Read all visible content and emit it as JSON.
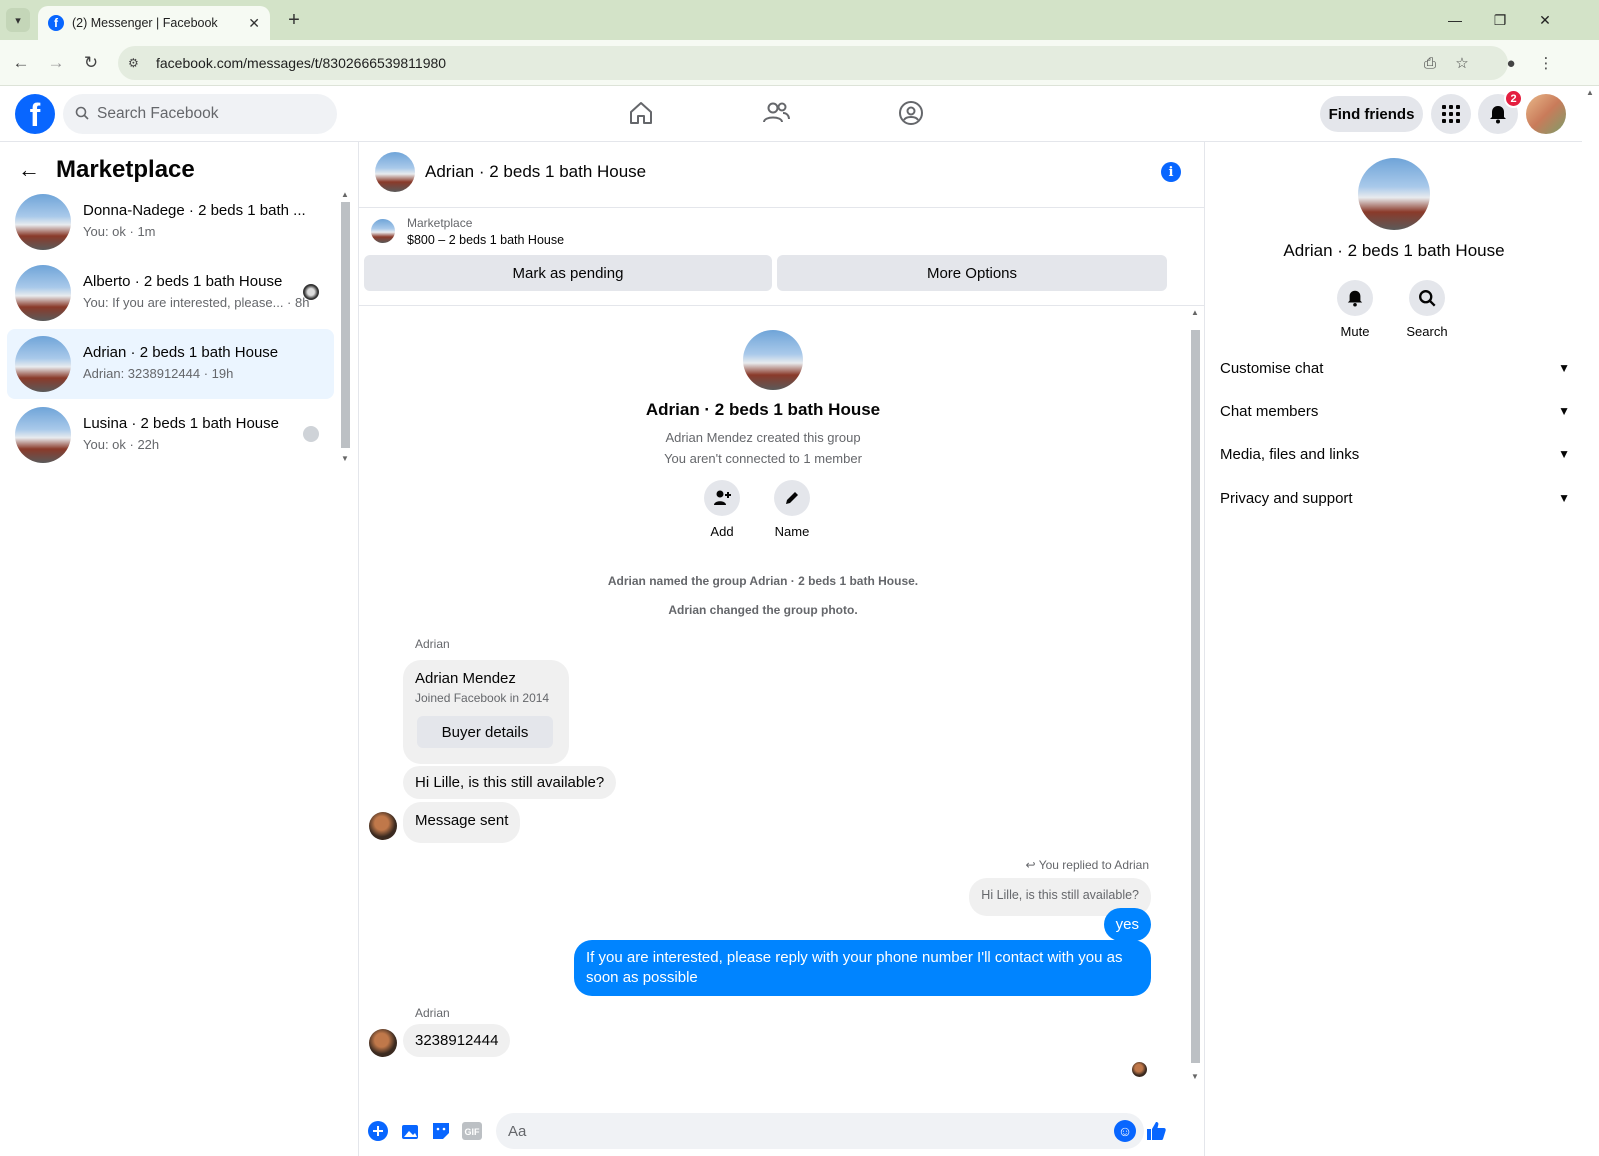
{
  "browser": {
    "tab_title": "(2) Messenger | Facebook",
    "url": "facebook.com/messages/t/8302666539811980"
  },
  "header": {
    "search_placeholder": "Search Facebook",
    "find_friends": "Find friends",
    "notification_count": "2"
  },
  "sidebar": {
    "title": "Marketplace",
    "conversations": [
      {
        "name": "Donna-Nadege · 2 beds 1 bath ...",
        "preview": "You: ok · 1m",
        "active": false
      },
      {
        "name": "Alberto · 2 beds 1 bath House",
        "preview": "You: If you are interested, please... · 8h",
        "active": false
      },
      {
        "name": "Adrian · 2 beds 1 bath House",
        "preview": "Adrian: 3238912444 · 19h",
        "active": true
      },
      {
        "name": "Lusina · 2 beds 1 bath House",
        "preview": "You: ok · 22h",
        "active": false
      }
    ]
  },
  "chat": {
    "title": "Adrian · 2 beds 1 bath House",
    "marketplace_label": "Marketplace",
    "listing": "$800 – 2 beds 1 bath House",
    "mark_pending": "Mark as pending",
    "more_options": "More Options",
    "group_name": "Adrian · 2 beds 1 bath House",
    "created_by": "Adrian Mendez created this group",
    "connection": "You aren't connected to 1 member",
    "add_label": "Add",
    "name_label": "Name",
    "sys_named": "Adrian named the group Adrian · 2 beds 1 bath House.",
    "sys_photo": "Adrian changed the group photo.",
    "sender_1": "Adrian",
    "card_name": "Adrian Mendez",
    "card_joined": "Joined Facebook in 2014",
    "buyer_details": "Buyer details",
    "msg_available": "Hi Lille, is this still available?",
    "msg_sent": "Message sent",
    "replied_to": "You replied to Adrian",
    "quoted": "Hi Lille, is this still available?",
    "msg_yes": "yes",
    "msg_interested": "If you are interested, please reply with your phone number  I'll contact with you as soon as possible",
    "sender_2": "Adrian",
    "msg_phone": "3238912444",
    "composer_placeholder": "Aa"
  },
  "details": {
    "name": "Adrian · 2 beds 1 bath House",
    "mute": "Mute",
    "search": "Search",
    "sections": [
      "Customise chat",
      "Chat members",
      "Media, files and links",
      "Privacy and support"
    ]
  },
  "colors": {
    "brand": "#0866ff",
    "outgoing_bubble": "#0084ff",
    "active_row": "#ebf5ff"
  }
}
